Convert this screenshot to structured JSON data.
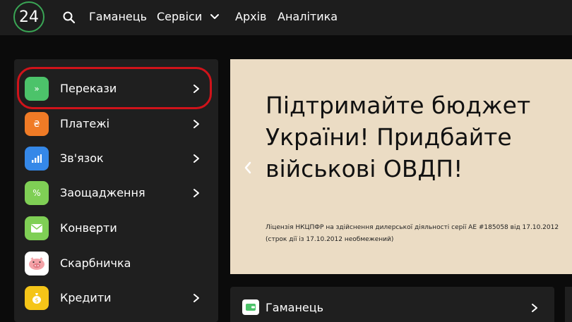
{
  "header": {
    "logo_text": "24",
    "nav": [
      {
        "label": "Гаманець"
      },
      {
        "label": "Сервіси"
      },
      {
        "label": "Архів"
      },
      {
        "label": "Аналітика"
      }
    ],
    "icons": {
      "search": "search-icon",
      "dropdown": "chevron-down-icon"
    }
  },
  "sidebar": {
    "items": [
      {
        "label": "Перекази",
        "icon": "transfer-icon",
        "glyph": "»",
        "color": "#4cc36a",
        "highlighted": true
      },
      {
        "label": "Платежі",
        "icon": "payment-icon",
        "glyph": "₴",
        "color": "#f07b26"
      },
      {
        "label": "Зв'язок",
        "icon": "signal-icon",
        "glyph": "▮",
        "color": "#3588e8"
      },
      {
        "label": "Заощадження",
        "icon": "percent-icon",
        "glyph": "%",
        "color": "#7fcf55"
      },
      {
        "label": "Конверти",
        "icon": "envelope-icon",
        "glyph": "✉",
        "color": "#7fcf55"
      },
      {
        "label": "Скарбничка",
        "icon": "piggy-bank-icon",
        "glyph": "🐷",
        "color": "#ffffff"
      },
      {
        "label": "Кредити",
        "icon": "money-bag-icon",
        "glyph": "$",
        "color": "#f5c518"
      }
    ],
    "highlight_color": "#d0131a"
  },
  "banner": {
    "headline": "Підтримайте бюджет України! Придбайте військові ОВДП!",
    "license": "Ліцензія НКЦПФР на здійснення дилерської діяльності серії АЕ #185058 від 17.10.2012 (строк дії із 17.10.2012 необмежений)",
    "background": "#ebdcc4"
  },
  "wallet_card": {
    "label": "Гаманець",
    "icon": "wallet-icon"
  }
}
